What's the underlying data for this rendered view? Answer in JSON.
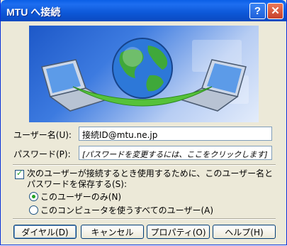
{
  "window": {
    "title": "MTU へ接続"
  },
  "titlebar": {
    "help_label": "?",
    "close_label": "✕"
  },
  "form": {
    "username_label": "ユーザー名(U):",
    "username_value": "接続ID@mtu.ne.jp",
    "password_label": "パスワード(P):",
    "password_value": "[パスワードを変更するには、ここをクリックします]",
    "save_checkbox_label": "次のユーザーが接続するとき使用するために、このユーザー名とパスワードを保存する(S):",
    "save_checked": true,
    "radio_me_label": "このユーザーのみ(N)",
    "radio_anyone_label": "このコンピュータを使うすべてのユーザー(A)",
    "radio_selected": "me"
  },
  "buttons": {
    "dial": "ダイヤル(D)",
    "cancel": "キャンセル",
    "properties": "プロパティ(O)",
    "help": "ヘルプ(H)"
  },
  "colors": {
    "titlebar": "#0a5fe6",
    "dialog_bg": "#ece9d8",
    "banner": "#1d58c8",
    "close": "#c8402a"
  },
  "icons": [
    "help-icon",
    "close-icon",
    "globe-icon",
    "laptop-icon",
    "checkmark-icon"
  ]
}
